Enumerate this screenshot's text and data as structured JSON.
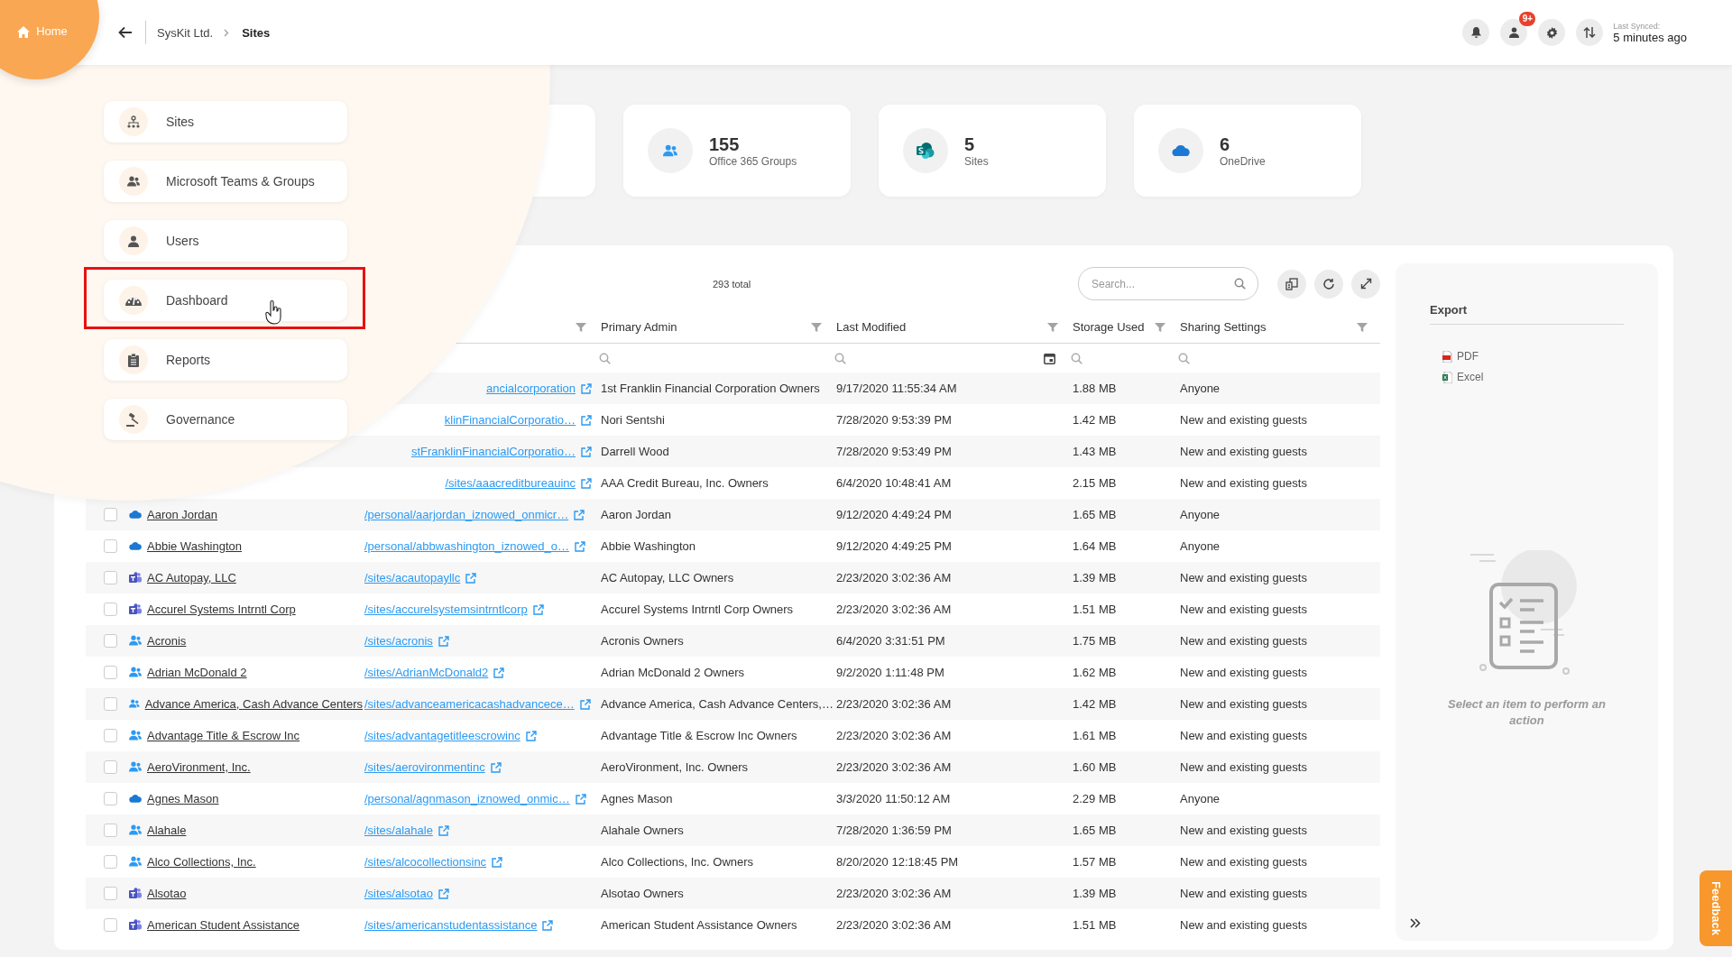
{
  "topbar": {
    "home": "Home",
    "breadcrumb": [
      {
        "label": "SysKit Ltd.",
        "current": false
      },
      {
        "label": "Sites",
        "current": true
      }
    ],
    "notification_badge": "9+",
    "sync_label": "Last Synced:",
    "sync_time": "5 minutes ago"
  },
  "menu": [
    {
      "label": "Sites",
      "kind": "sites",
      "highlighted": false
    },
    {
      "label": "Microsoft Teams & Groups",
      "kind": "groups",
      "highlighted": false
    },
    {
      "label": "Users",
      "kind": "user",
      "highlighted": false
    },
    {
      "label": "Dashboard",
      "kind": "dashboard",
      "highlighted": true
    },
    {
      "label": "Reports",
      "kind": "reports",
      "highlighted": false
    },
    {
      "label": "Governance",
      "kind": "governance",
      "highlighted": false
    }
  ],
  "stats": [
    {
      "value": "155",
      "label": "Office 365 Groups",
      "kind": "groups"
    },
    {
      "value": "5",
      "label": "Sites",
      "kind": "sharepoint"
    },
    {
      "value": "6",
      "label": "OneDrive",
      "kind": "onedrive"
    }
  ],
  "table": {
    "total": "293 total",
    "search": {
      "placeholder": "Search..."
    },
    "columns": [
      {
        "label": "Primary Admin",
        "kind": "text"
      },
      {
        "label": "Last Modified",
        "kind": "date"
      },
      {
        "label": "Storage Used",
        "kind": "text"
      },
      {
        "label": "Sharing Settings",
        "kind": "text"
      }
    ],
    "rows": [
      {
        "kind": "covered",
        "url": "ancialcorporation",
        "cells": [
          "1st Franklin Financial Corporation Owners",
          "9/17/2020 11:55:34 AM",
          "1.88 MB",
          "Anyone"
        ]
      },
      {
        "kind": "covered",
        "url": "klinFinancialCorporatio…",
        "cells": [
          "Nori Sentshi",
          "7/28/2020 9:53:39 PM",
          "1.42 MB",
          "New and existing guests"
        ]
      },
      {
        "kind": "covered",
        "url": "stFranklinFinancialCorporatio…",
        "cells": [
          "Darrell Wood",
          "7/28/2020 9:53:49 PM",
          "1.43 MB",
          "New and existing guests"
        ]
      },
      {
        "kind": "covered",
        "url": "/sites/aaacreditbureauinc",
        "cells": [
          "AAA Credit Bureau, Inc. Owners",
          "6/4/2020 10:48:41 AM",
          "2.15 MB",
          "New and existing guests"
        ]
      },
      {
        "kind": "onedrive",
        "checked": false,
        "name": "Aaron Jordan",
        "url": "/personal/aarjordan_iznowed_onmicr…",
        "cells": [
          "Aaron Jordan",
          "9/12/2020 4:49:24 PM",
          "1.65 MB",
          "Anyone"
        ]
      },
      {
        "kind": "onedrive",
        "checked": false,
        "name": "Abbie Washington",
        "url": "/personal/abbwashington_iznowed_o…",
        "cells": [
          "Abbie Washington",
          "9/12/2020 4:49:25 PM",
          "1.64 MB",
          "Anyone"
        ]
      },
      {
        "kind": "teams",
        "checked": false,
        "name": "AC Autopay, LLC",
        "url": "/sites/acautopayllc",
        "cells": [
          "AC Autopay, LLC Owners",
          "2/23/2020 3:02:36 AM",
          "1.39 MB",
          "New and existing guests"
        ]
      },
      {
        "kind": "teams",
        "checked": false,
        "name": "Accurel Systems Intrntl Corp",
        "url": "/sites/accurelsystemsintrntlcorp",
        "cells": [
          "Accurel Systems Intrntl Corp Owners",
          "2/23/2020 3:02:36 AM",
          "1.51 MB",
          "New and existing guests"
        ]
      },
      {
        "kind": "group",
        "checked": false,
        "name": "Acronis",
        "url": "/sites/acronis",
        "cells": [
          "Acronis Owners",
          "6/4/2020 3:31:51 PM",
          "1.75 MB",
          "New and existing guests"
        ]
      },
      {
        "kind": "group",
        "checked": false,
        "name": "Adrian McDonald 2",
        "url": "/sites/AdrianMcDonald2",
        "cells": [
          "Adrian McDonald 2 Owners",
          "9/2/2020 1:11:48 PM",
          "1.62 MB",
          "New and existing guests"
        ]
      },
      {
        "kind": "group",
        "checked": false,
        "name": "Advance America, Cash Advance Centers",
        "url": "/sites/advanceamericacashadvancece…",
        "cells": [
          "Advance America, Cash Advance Centers,…",
          "2/23/2020 3:02:36 AM",
          "1.42 MB",
          "New and existing guests"
        ]
      },
      {
        "kind": "group",
        "checked": false,
        "name": "Advantage Title & Escrow Inc",
        "url": "/sites/advantagetitleescrowinc",
        "cells": [
          "Advantage Title & Escrow Inc Owners",
          "2/23/2020 3:02:36 AM",
          "1.61 MB",
          "New and existing guests"
        ]
      },
      {
        "kind": "group",
        "checked": false,
        "name": "AeroVironment, Inc.",
        "url": "/sites/aerovironmentinc",
        "cells": [
          "AeroVironment, Inc. Owners",
          "2/23/2020 3:02:36 AM",
          "1.60 MB",
          "New and existing guests"
        ]
      },
      {
        "kind": "onedrive",
        "checked": false,
        "name": "Agnes Mason",
        "url": "/personal/agnmason_iznowed_onmic…",
        "cells": [
          "Agnes Mason",
          "3/3/2020 11:50:12 AM",
          "2.29 MB",
          "Anyone"
        ]
      },
      {
        "kind": "group",
        "checked": false,
        "name": "Alahale",
        "url": "/sites/alahale",
        "cells": [
          "Alahale Owners",
          "7/28/2020 1:36:59 PM",
          "1.65 MB",
          "New and existing guests"
        ]
      },
      {
        "kind": "group",
        "checked": false,
        "name": "Alco Collections, Inc.",
        "url": "/sites/alcocollectionsinc",
        "cells": [
          "Alco Collections, Inc. Owners",
          "8/20/2020 12:18:45 PM",
          "1.57 MB",
          "New and existing guests"
        ]
      },
      {
        "kind": "teams",
        "checked": false,
        "name": "Alsotao",
        "url": "/sites/alsotao",
        "cells": [
          "Alsotao Owners",
          "2/23/2020 3:02:36 AM",
          "1.39 MB",
          "New and existing guests"
        ]
      },
      {
        "kind": "teams",
        "checked": false,
        "name": "American Student Assistance",
        "url": "/sites/americanstudentassistance",
        "cells": [
          "American Student Assistance Owners",
          "2/23/2020 3:02:36 AM",
          "1.51 MB",
          "New and existing guests"
        ]
      }
    ]
  },
  "side_panel": {
    "title": "Export",
    "actions": [
      {
        "label": "PDF",
        "kind": "pdf"
      },
      {
        "label": "Excel",
        "kind": "excel"
      }
    ],
    "message": "Select an item to perform an action"
  },
  "feedback": "Feedback"
}
